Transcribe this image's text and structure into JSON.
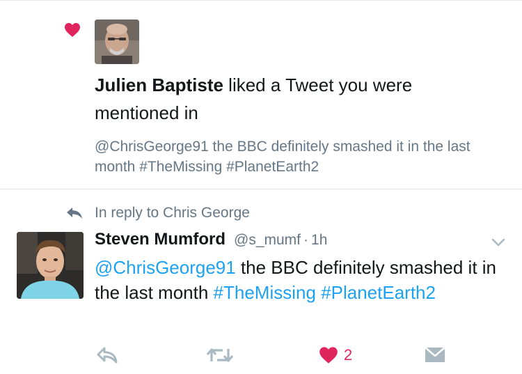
{
  "notification": {
    "actor_name": "Julien Baptiste",
    "action_text": " liked a Tweet you were mentioned in",
    "quoted_tweet": "@ChrisGeorge91 the BBC definitely smashed it in the last month #TheMissing #PlanetEarth2",
    "icon": "heart-icon",
    "icon_color": "#e0245e"
  },
  "tweet": {
    "reply_context": "In reply to Chris George",
    "author_name": "Steven Mumford",
    "author_handle": "@s_mumf",
    "separator": "·",
    "time": "1h",
    "body": {
      "mention": "@ChrisGeorge91",
      "text": " the BBC definitely smashed it in the last month ",
      "hashtag1": "#TheMissing",
      "hashtag2": "#PlanetEarth2"
    },
    "actions": {
      "reply_icon": "reply-icon",
      "retweet_icon": "retweet-icon",
      "like_icon": "heart-icon",
      "like_count": "2",
      "dm_icon": "envelope-icon"
    }
  },
  "colors": {
    "link": "#1da1f2",
    "muted": "#657786",
    "like": "#e0245e",
    "text": "#14171a"
  }
}
